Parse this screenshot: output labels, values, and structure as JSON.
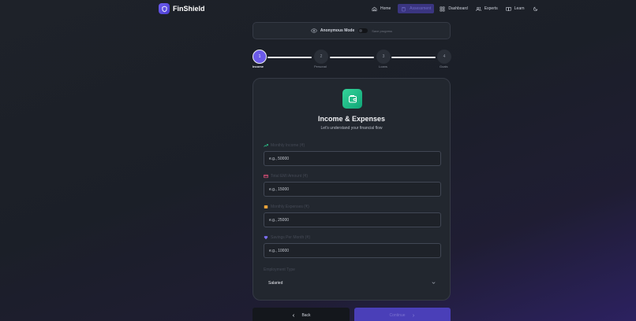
{
  "brand": {
    "name": "FinShield"
  },
  "nav": {
    "items": [
      {
        "label": "Home",
        "icon": "home-icon"
      },
      {
        "label": "Assessment",
        "icon": "clipboard-icon",
        "active": true
      },
      {
        "label": "Dashboard",
        "icon": "grid-icon"
      },
      {
        "label": "Experts",
        "icon": "users-icon"
      },
      {
        "label": "Learn",
        "icon": "book-icon"
      }
    ],
    "theme_icon": "moon-icon"
  },
  "anonymous": {
    "label": "Anonymous Mode",
    "sublabel": "Save progress",
    "enabled": false
  },
  "stepper": {
    "steps": [
      {
        "number": "1",
        "label": "Income",
        "active": true
      },
      {
        "number": "2",
        "label": "Personal"
      },
      {
        "number": "3",
        "label": "Loans"
      },
      {
        "number": "4",
        "label": "Goals"
      }
    ]
  },
  "card": {
    "icon": "wallet-icon",
    "title": "Income & Expenses",
    "subtitle": "Let's understand your financial flow",
    "fields": [
      {
        "label": "Monthly Income (₹)",
        "placeholder": "e.g., 50000",
        "icon": "trend-icon",
        "color": "#2bc48a"
      },
      {
        "label": "Total EMI Amount (₹)",
        "placeholder": "e.g., 15000",
        "icon": "card-icon",
        "color": "#e0507a"
      },
      {
        "label": "Monthly Expenses (₹)",
        "placeholder": "e.g., 25000",
        "icon": "cart-icon",
        "color": "#e8a23a"
      },
      {
        "label": "Savings Per Month (₹)",
        "placeholder": "e.g., 10000",
        "icon": "piggy-icon",
        "color": "#7c6ef0"
      }
    ],
    "employment": {
      "label": "Employment Type",
      "value": "Salaried"
    }
  },
  "actions": {
    "back": "Back",
    "continue": "Continue"
  },
  "colors": {
    "accent": "#6b5ae8",
    "success": "#10a577"
  }
}
